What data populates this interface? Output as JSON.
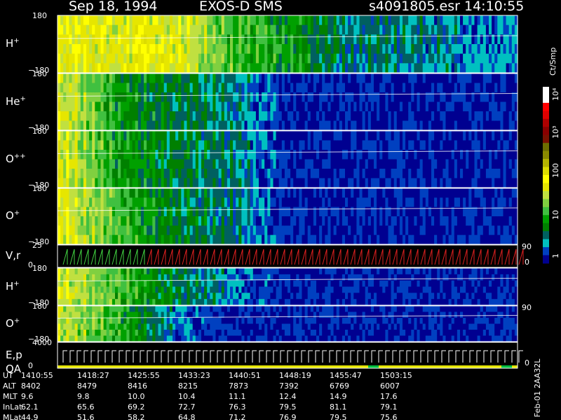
{
  "header": {
    "date": "Sep 18, 1994",
    "instrument": "EXOS-D SMS",
    "file": "s4091805.esr",
    "time": "14:10:55"
  },
  "panels": [
    {
      "label": "H",
      "sup": "+",
      "ymax": "180",
      "ymin": "−180"
    },
    {
      "label": "He",
      "sup": "+",
      "ymax": "180",
      "ymin": "−180"
    },
    {
      "label": "O",
      "sup": "++",
      "ymax": "180",
      "ymin": "−180"
    },
    {
      "label": "O",
      "sup": "+",
      "ymax": "180",
      "ymin": "−180"
    },
    {
      "label": "V,r",
      "sup": "",
      "ymax": "25",
      "ymin": "0",
      "right_top": "90",
      "right_bottom": "0"
    },
    {
      "label": "H",
      "sup": "+",
      "ymax": "180",
      "ymin": "−180"
    },
    {
      "label": "O",
      "sup": "+",
      "ymax": "180",
      "ymin": "−180",
      "right_top": "90"
    },
    {
      "label": "E,p",
      "label2": "QA",
      "ymax": "4000",
      "ymin": "0",
      "right_bottom": "0"
    }
  ],
  "colorbar": {
    "unit": "Ct/Smp",
    "labels": [
      "10⁴",
      "10³",
      "100",
      "10",
      "1"
    ],
    "colors": [
      "#ffffff",
      "#ffffff",
      "#ff0000",
      "#e00000",
      "#b00000",
      "#8a0000",
      "#7a1000",
      "#6e6e00",
      "#8a8a00",
      "#b4b400",
      "#dcdc00",
      "#ffff00",
      "#e6e600",
      "#c0e040",
      "#80d040",
      "#40c040",
      "#00a000",
      "#008000",
      "#006060",
      "#00c0c0",
      "#0040c0",
      "#000090"
    ]
  },
  "footer": {
    "rows": [
      {
        "label": "UT",
        "values": [
          "1410:55",
          "1418:27",
          "1425:55",
          "1433:23",
          "1440:51",
          "1448:19",
          "1455:47",
          "1503:15"
        ]
      },
      {
        "label": "ALT",
        "values": [
          "8402",
          "8479",
          "8416",
          "8215",
          "7873",
          "7392",
          "6769",
          "6007"
        ]
      },
      {
        "label": "MLT",
        "values": [
          "9.6",
          "9.8",
          "10.0",
          "10.4",
          "11.1",
          "12.4",
          "14.9",
          "17.6"
        ]
      },
      {
        "label": "InLat",
        "values": [
          "62.1",
          "65.6",
          "69.2",
          "72.7",
          "76.3",
          "79.5",
          "81.1",
          "79.1"
        ]
      },
      {
        "label": "MLat",
        "values": [
          "44.9",
          "51.6",
          "58.2",
          "64.8",
          "71.2",
          "76.9",
          "79.5",
          "75.6"
        ]
      }
    ],
    "stamp": "Feb-01 2AA32L"
  },
  "chart_data": {
    "type": "heatmap",
    "title": "Sep 18, 1994 EXOS-D SMS",
    "x": [
      "1410:55",
      "1418:27",
      "1425:55",
      "1433:23",
      "1440:51",
      "1448:19",
      "1455:47",
      "1503:15"
    ],
    "series": [
      {
        "name": "H+",
        "ylim": [
          -180,
          180
        ],
        "level_by_segment": [
          100,
          100,
          100,
          20,
          10,
          3,
          3,
          2
        ]
      },
      {
        "name": "He+",
        "ylim": [
          -180,
          180
        ],
        "level_by_segment": [
          100,
          10,
          5,
          3,
          1,
          1,
          1,
          1
        ]
      },
      {
        "name": "O++",
        "ylim": [
          -180,
          180
        ],
        "level_by_segment": [
          100,
          10,
          5,
          3,
          1,
          1,
          1,
          1
        ]
      },
      {
        "name": "O+",
        "ylim": [
          -180,
          180
        ],
        "level_by_segment": [
          100,
          20,
          5,
          3,
          1,
          1,
          1,
          1
        ]
      },
      {
        "name": "V,r",
        "ylim": [
          0,
          25
        ],
        "right_ylim": [
          0,
          90
        ]
      },
      {
        "name": "H+",
        "ylim": [
          -180,
          180
        ],
        "level_by_segment": [
          80,
          20,
          5,
          2,
          1,
          1,
          1,
          1
        ]
      },
      {
        "name": "O+",
        "ylim": [
          -180,
          180
        ],
        "level_by_segment": [
          60,
          15,
          2,
          1,
          1,
          1,
          1,
          1
        ]
      },
      {
        "name": "E,p",
        "ylim": [
          0,
          4000
        ]
      }
    ],
    "colorbar": {
      "label": "Ct/Smp",
      "range": [
        1,
        10000
      ],
      "scale": "log"
    }
  }
}
